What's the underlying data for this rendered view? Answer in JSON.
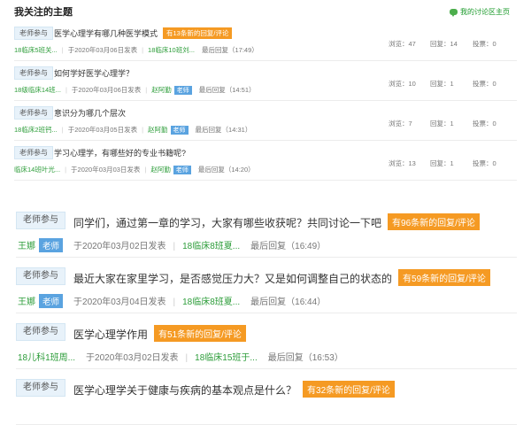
{
  "header": {
    "title": "我关注的主题",
    "my_link": "我的讨论区主页"
  },
  "stat_labels": {
    "views": "浏览：",
    "replies": "回复：",
    "votes": "投票："
  },
  "small_topics": [
    {
      "tag": "老师参与",
      "title": "医学心理学有哪几种医学模式",
      "badge": "有13条新的回复/评论",
      "author": "18临床5班关...",
      "author_teacher": "",
      "date": "于2020年03月06日发表",
      "last": "18临床10班刘...",
      "last_reply": "最后回复（17:49）",
      "views": "47",
      "replies": "14",
      "votes": "0"
    },
    {
      "tag": "老师参与",
      "title": "如何学好医学心理学？",
      "badge": "",
      "author": "18级临床14班...",
      "author_teacher": "",
      "date": "于2020年03月06日发表",
      "last": "赵阿勤",
      "last_teacher": "老师",
      "last_reply": "最后回复（14:51）",
      "views": "10",
      "replies": "1",
      "votes": "0"
    },
    {
      "tag": "老师参与",
      "title": "意识分为哪几个层次",
      "badge": "",
      "author": "18临床2班钙...",
      "author_teacher": "",
      "date": "于2020年03月05日发表",
      "last": "赵阿勤",
      "last_teacher": "老师",
      "last_reply": "最后回复（14:31）",
      "views": "7",
      "replies": "1",
      "votes": "0"
    },
    {
      "tag": "老师参与",
      "title": "学习心理学，有哪些好的专业书籍呢?",
      "badge": "",
      "author": "临床14班叶光...",
      "author_teacher": "",
      "date": "于2020年03月03日发表",
      "last": "赵阿勤",
      "last_teacher": "老师",
      "last_reply": "最后回复（14:20）",
      "views": "13",
      "replies": "1",
      "votes": "0"
    }
  ],
  "big_topics": [
    {
      "tag": "老师参与",
      "title": "同学们，通过第一章的学习，大家有哪些收获呢？共同讨论一下吧",
      "badge": "有96条新的回复/评论",
      "author": "王娜",
      "author_teacher": "老师",
      "date": "于2020年03月02日发表",
      "last": "18临床8班夏...",
      "last_reply": "最后回复（16:49）"
    },
    {
      "tag": "老师参与",
      "title": "最近大家在家里学习，是否感觉压力大？又是如何调整自己的状态的",
      "badge": "有59条新的回复/评论",
      "author": "王娜",
      "author_teacher": "老师",
      "date": "于2020年03月04日发表",
      "last": "18临床8班夏...",
      "last_reply": "最后回复（16:44）"
    },
    {
      "tag": "老师参与",
      "title": "医学心理学作用",
      "badge": "有51条新的回复/评论",
      "author": "18儿科1班周...",
      "author_teacher": "",
      "date": "于2020年03月02日发表",
      "last": "18临床15班于...",
      "last_reply": "最后回复（16:53）"
    },
    {
      "tag": "老师参与",
      "title": "医学心理学关于健康与疾病的基本观点是什么？",
      "badge": "有32条新的回复/评论",
      "author": "",
      "author_teacher": "",
      "date": "",
      "last": "",
      "last_reply": ""
    }
  ]
}
